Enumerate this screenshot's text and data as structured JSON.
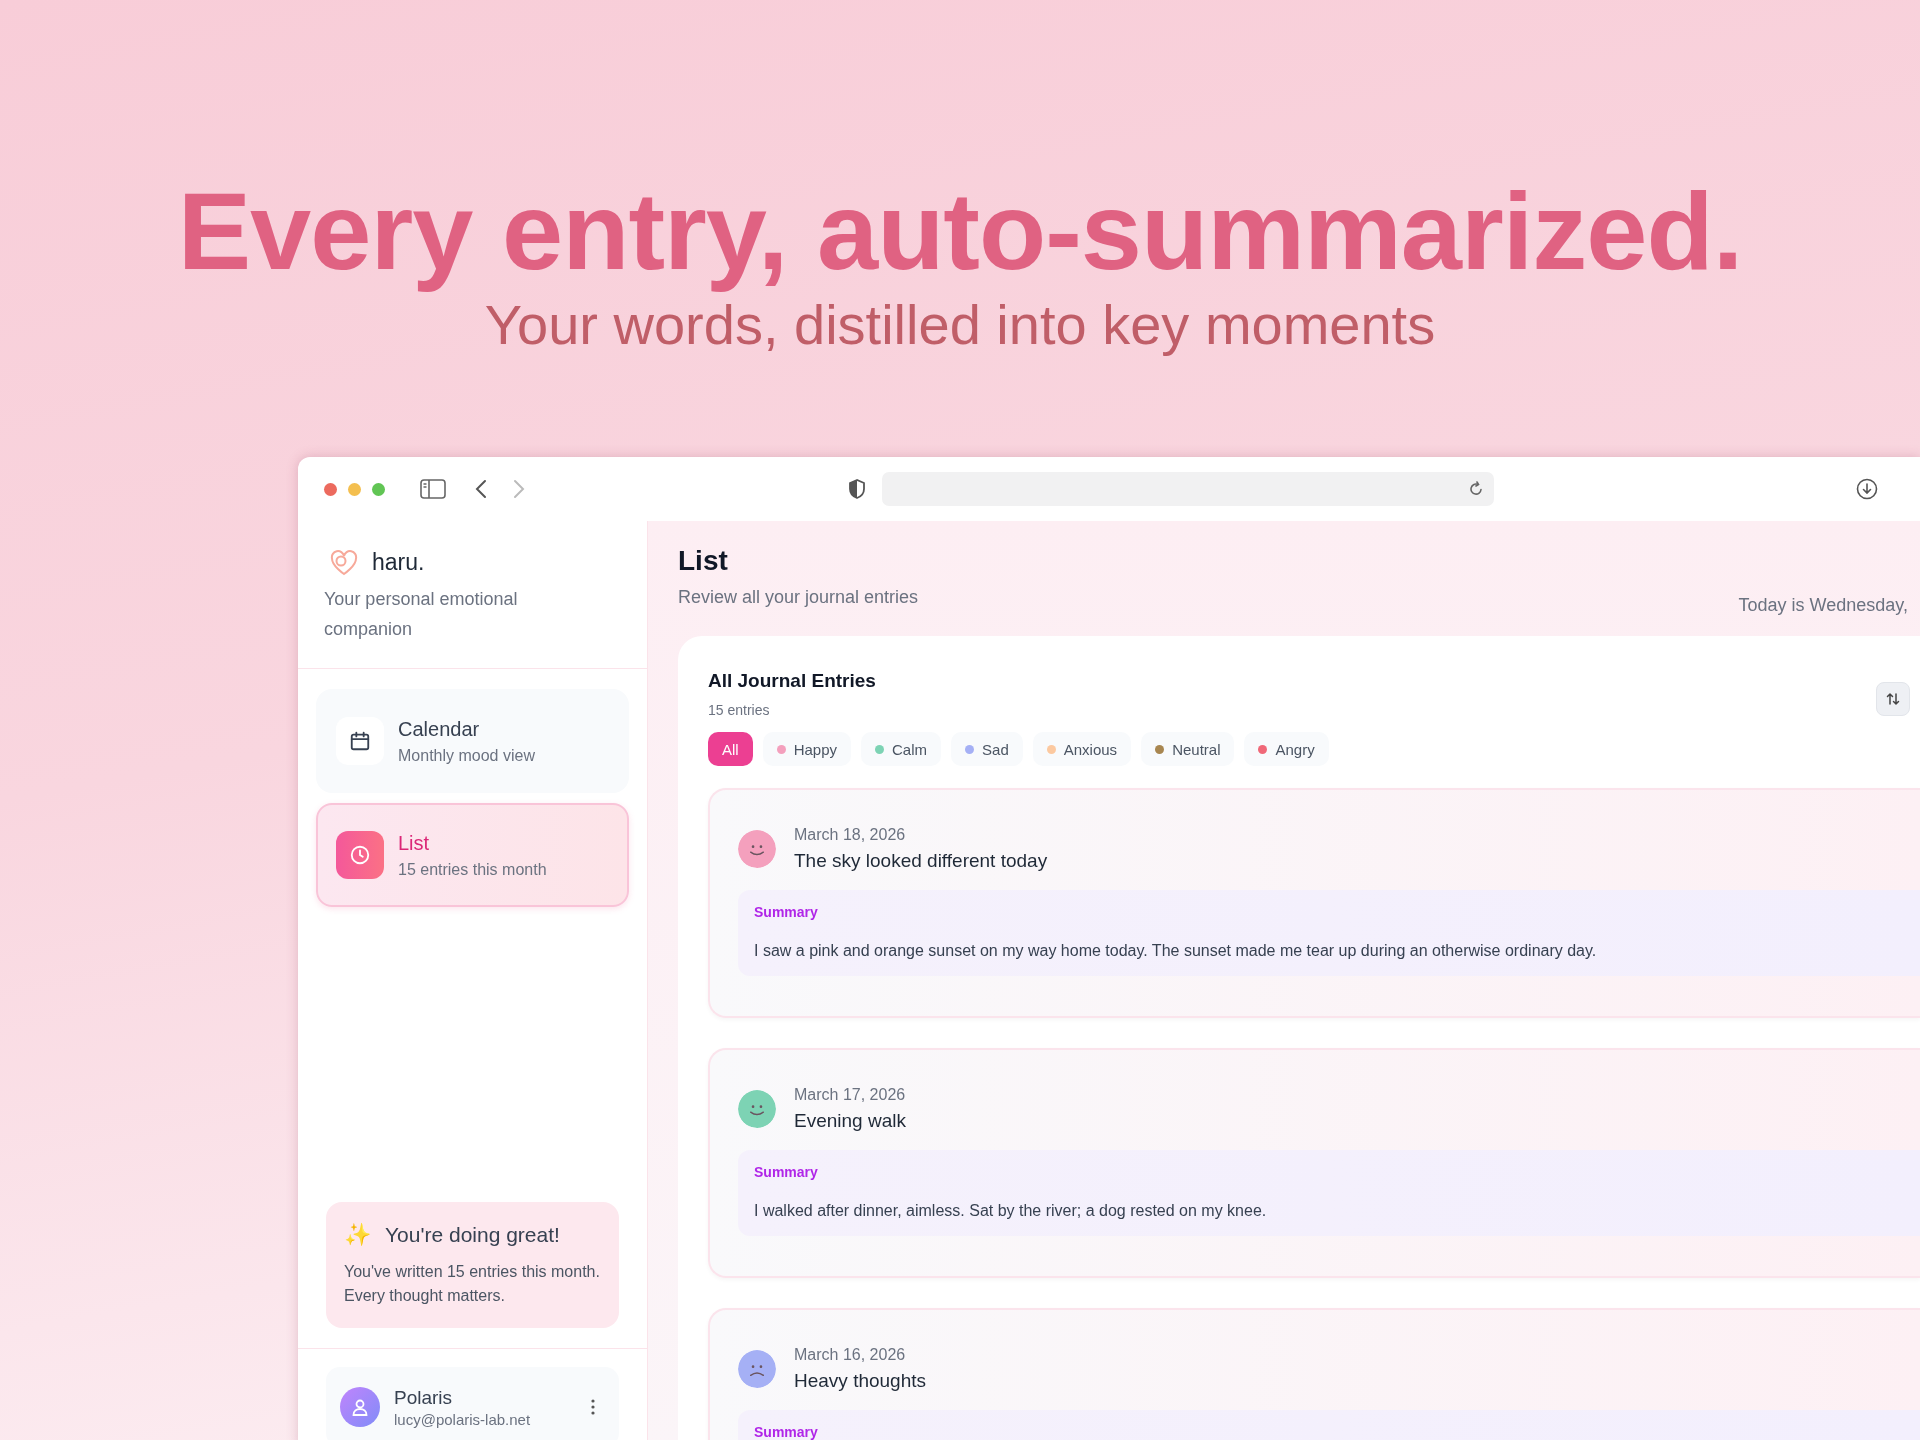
{
  "headline": "Every entry, auto-summarized.",
  "subheadline": "Your words, distilled into key moments",
  "sidebar": {
    "app_name": "haru.",
    "tagline": "Your personal emotional companion",
    "nav": [
      {
        "title": "Calendar",
        "subtitle": "Monthly mood view",
        "kind": "calendar",
        "selected": false
      },
      {
        "title": "List",
        "subtitle": "15 entries this month",
        "kind": "clock",
        "selected": true
      }
    ],
    "encouragement": {
      "icon": "✨",
      "title": "You're doing great!",
      "text": "You've written 15 entries this month. Every thought matters."
    },
    "user": {
      "name": "Polaris",
      "email": "lucy@polaris-lab.net"
    }
  },
  "main": {
    "title": "List",
    "subtitle": "Review all your journal entries",
    "today": "Today is Wednesday,",
    "entries_card": {
      "title": "All Journal Entries",
      "count": "15 entries",
      "filters": [
        {
          "label": "All",
          "selected": true
        },
        {
          "label": "Happy",
          "color": "#f4a0bd",
          "selected": false
        },
        {
          "label": "Calm",
          "color": "#7dd3b4",
          "selected": false
        },
        {
          "label": "Sad",
          "color": "#a5b0f5",
          "selected": false
        },
        {
          "label": "Anxious",
          "color": "#fcc9a0",
          "selected": false
        },
        {
          "label": "Neutral",
          "color": "#a88650",
          "selected": false
        },
        {
          "label": "Angry",
          "color": "#f06878",
          "selected": false
        }
      ],
      "entries": [
        {
          "date": "March 18, 2026",
          "title": "The sky looked different today",
          "color": "#f4a0bd",
          "kind": "smile",
          "summary_label": "Summary",
          "summary": "I saw a pink and orange sunset on my way home today. The sunset made me tear up during an otherwise ordinary day."
        },
        {
          "date": "March 17, 2026",
          "title": "Evening walk",
          "color": "#7dd3b4",
          "kind": "smile",
          "summary_label": "Summary",
          "summary": "I walked after dinner, aimless. Sat by the river; a dog rested on my knee."
        },
        {
          "date": "March 16, 2026",
          "title": "Heavy thoughts",
          "color": "#a5b0f5",
          "kind": "frown",
          "summary_label": "Summary"
        }
      ]
    }
  }
}
